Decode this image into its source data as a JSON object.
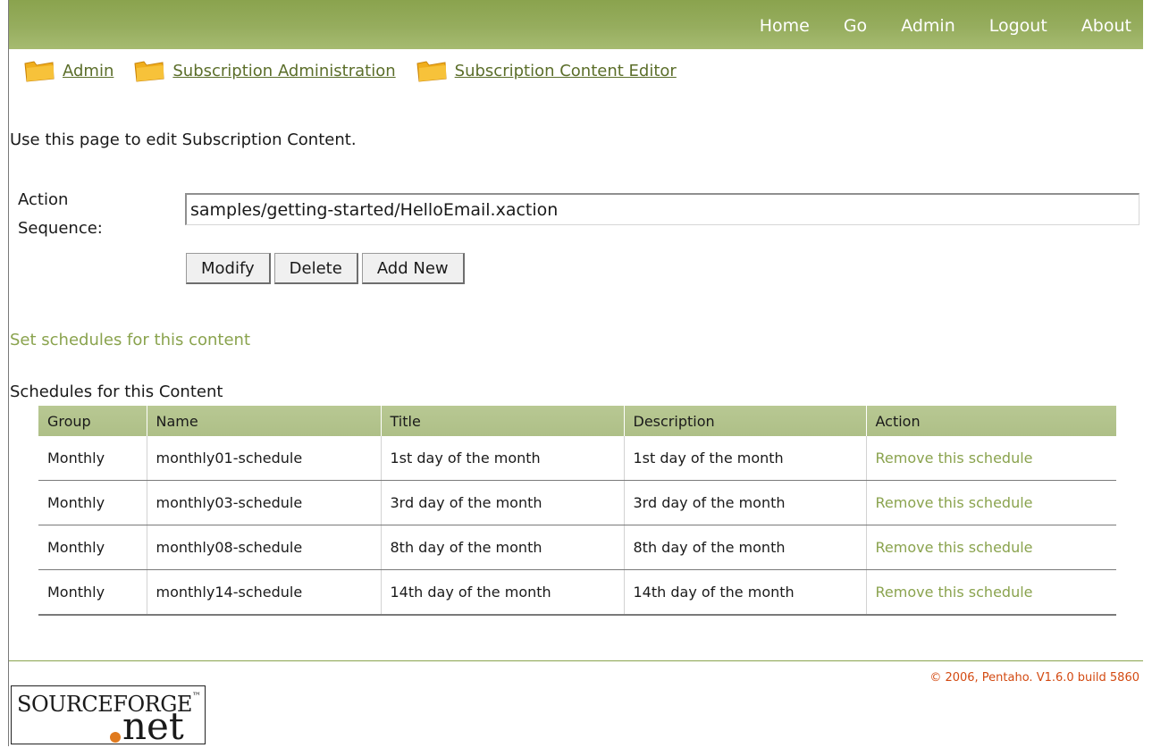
{
  "nav": {
    "items": [
      "Home",
      "Go",
      "Admin",
      "Logout",
      "About"
    ]
  },
  "breadcrumb": {
    "items": [
      "Admin",
      "Subscription Administration",
      "Subscription Content Editor"
    ]
  },
  "intro": "Use this page to edit Subscription Content.",
  "form": {
    "label": "Action Sequence:",
    "value": "samples/getting-started/HelloEmail.xaction",
    "buttons": {
      "modify": "Modify",
      "delete": "Delete",
      "add_new": "Add New"
    }
  },
  "schedule_link": "Set schedules for this content",
  "table": {
    "caption": "Schedules for this Content",
    "headers": [
      "Group",
      "Name",
      "Title",
      "Description",
      "Action"
    ],
    "rows": [
      [
        "Monthly",
        "monthly01-schedule",
        "1st day of the month",
        "1st day of the month",
        "Remove this schedule"
      ],
      [
        "Monthly",
        "monthly03-schedule",
        "3rd day of the month",
        "3rd day of the month",
        "Remove this schedule"
      ],
      [
        "Monthly",
        "monthly08-schedule",
        "8th day of the month",
        "8th day of the month",
        "Remove this schedule"
      ],
      [
        "Monthly",
        "monthly14-schedule",
        "14th day of the month",
        "14th day of the month",
        "Remove this schedule"
      ]
    ]
  },
  "footer": {
    "copyright": "© 2006, Pentaho. V1.6.0 build 5860",
    "logo": {
      "top": "SOURCEFORGE",
      "tm": "™",
      "net": "net"
    }
  },
  "colors": {
    "accent": "#8aa34e",
    "header_bg": "#aebf87",
    "copyright": "#d34a12",
    "folder": "#f0ae1c"
  },
  "icons": {
    "breadcrumb": "folder-icon"
  }
}
